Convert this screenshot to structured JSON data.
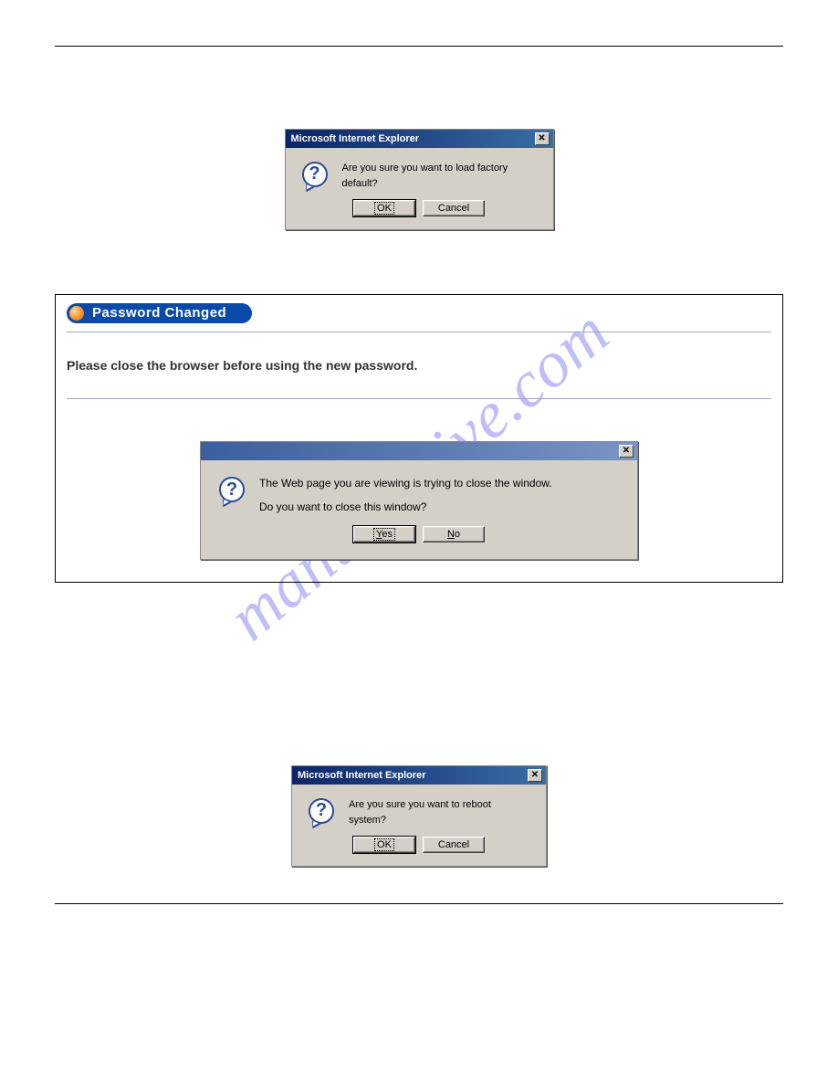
{
  "watermark": "manualshive.com",
  "dialog1": {
    "title": "Microsoft Internet Explorer",
    "message": "Are you sure you want to load factory default?",
    "ok": "OK",
    "cancel": "Cancel"
  },
  "panel": {
    "banner": "Password Changed",
    "instruction": "Please close the browser before using the new password."
  },
  "dialog2": {
    "line1": "The Web page you are viewing is trying to close the window.",
    "line2": "Do you want to close this window?",
    "yes_pre": "Y",
    "yes_rest": "es",
    "no_pre": "N",
    "no_rest": "o"
  },
  "dialog3": {
    "title": "Microsoft Internet Explorer",
    "message": "Are you sure you want to reboot system?",
    "ok": "OK",
    "cancel": "Cancel"
  }
}
